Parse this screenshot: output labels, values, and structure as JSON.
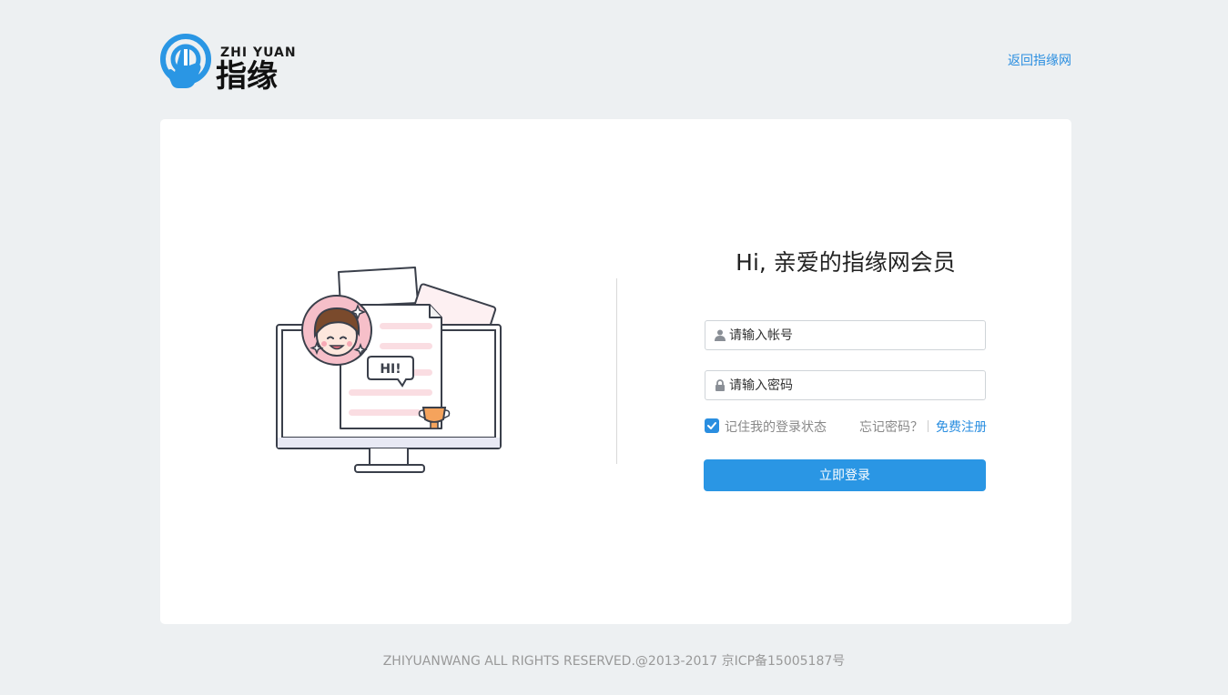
{
  "header": {
    "logo_en": "ZHI YUAN",
    "logo_cn": "指缘",
    "back_link": "返回指缘网"
  },
  "illustration": {
    "bubble_text": "HI!"
  },
  "login": {
    "greeting": "Hi, 亲爱的指缘网会员",
    "account_placeholder": "请输入帐号",
    "password_placeholder": "请输入密码",
    "remember_label": "记住我的登录状态",
    "remember_checked": true,
    "forgot_link": "忘记密码？",
    "register_link": "免费注册",
    "submit_label": "立即登录"
  },
  "footer": {
    "copyright": "ZHIYUANWANG ALL RIGHTS RESERVED.@2013-2017 京ICP备15005187号"
  },
  "colors": {
    "accent": "#2a96e4",
    "link": "#2a8ee0",
    "page_bg": "#edf0f2"
  }
}
